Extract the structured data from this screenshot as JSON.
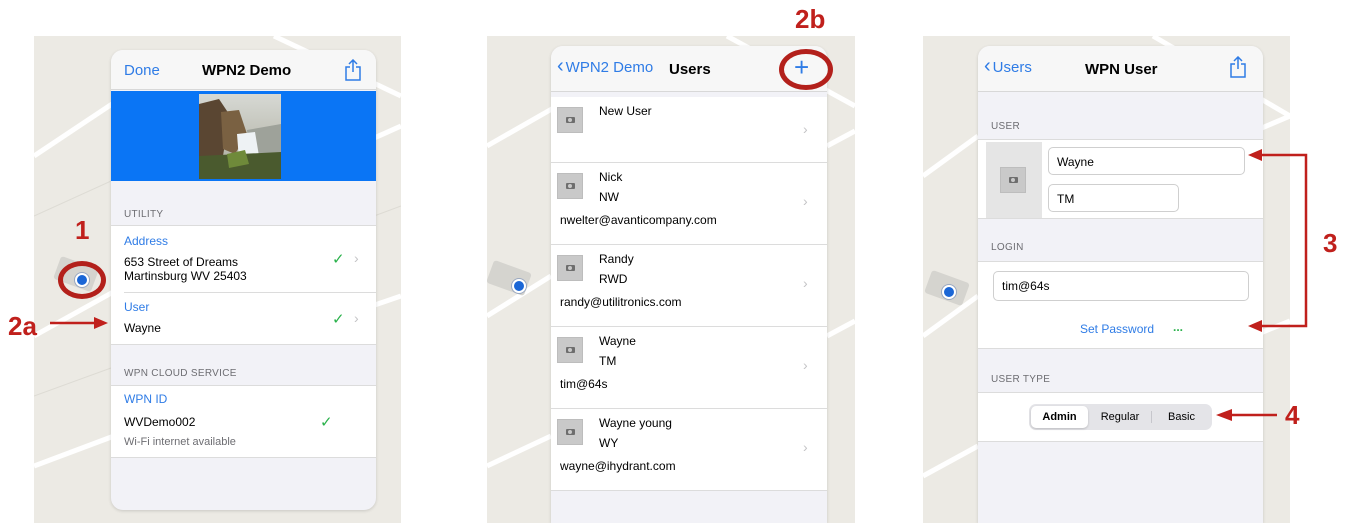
{
  "screen1": {
    "nav": {
      "done_label": "Done",
      "title": "WPN2 Demo",
      "share_icon": "share-icon"
    },
    "header_color": "#0a75f5",
    "utility": {
      "section_label": "UTILITY",
      "address_label": "Address",
      "address_line1": "653 Street of Dreams",
      "address_line2": "Martinsburg WV 25403",
      "user_label": "User",
      "user_value": "Wayne"
    },
    "cloud": {
      "section_label": "WPN CLOUD SERVICE",
      "wpn_id_label": "WPN ID",
      "wpn_id_value": "WVDemo002",
      "status": "Wi-Fi internet available"
    }
  },
  "screen2": {
    "nav": {
      "back_label": "WPN2 Demo",
      "title": "Users",
      "add_icon": "plus-icon"
    },
    "users": [
      {
        "name": "New User",
        "initials": "",
        "login": ""
      },
      {
        "name": "Nick",
        "initials": "NW",
        "login": "nwelter@avanticompany.com"
      },
      {
        "name": "Randy",
        "initials": "RWD",
        "login": "randy@utilitronics.com"
      },
      {
        "name": "Wayne",
        "initials": "TM",
        "login": "tim@64s"
      },
      {
        "name": "Wayne young",
        "initials": "WY",
        "login": "wayne@ihydrant.com"
      }
    ]
  },
  "screen3": {
    "nav": {
      "back_label": "Users",
      "title": "WPN User",
      "share_icon": "share-icon"
    },
    "user_section": "USER",
    "first_name": "Wayne",
    "initials": "TM",
    "login_section": "LOGIN",
    "login_value": "tim@64s",
    "set_password_label": "Set Password",
    "set_password_ellipsis": "...",
    "user_type_section": "USER TYPE",
    "user_type_options": [
      "Admin",
      "Regular",
      "Basic"
    ],
    "user_type_selected": "Admin"
  },
  "annotations": {
    "label_1": "1",
    "label_2a": "2a",
    "label_2b": "2b",
    "label_3": "3",
    "label_4": "4",
    "color": "#c0201c"
  }
}
